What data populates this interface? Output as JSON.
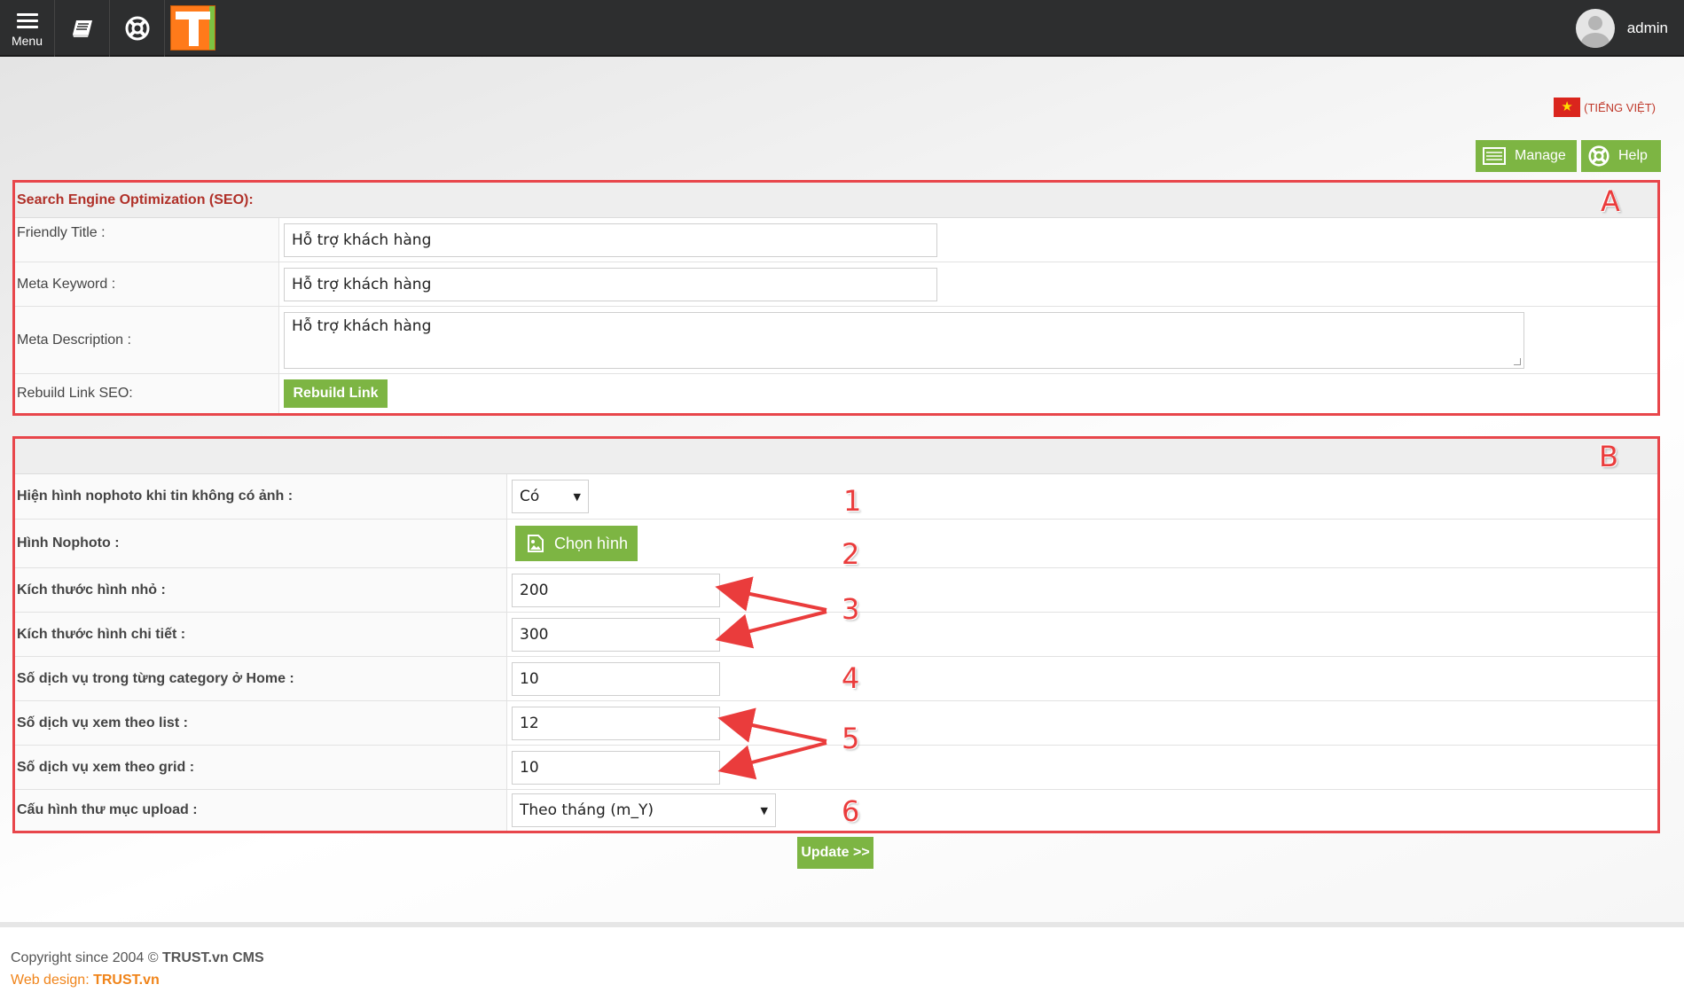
{
  "topbar": {
    "menu_label": "Menu",
    "user_name": "admin",
    "icons": {
      "menu": "hamburger-icon",
      "book": "book-icon",
      "help": "lifebuoy-icon",
      "logo": "trust-logo"
    }
  },
  "language": {
    "label": "(TIẾNG VIỆT)",
    "flag": "vietnam-flag-icon"
  },
  "actions": {
    "manage_label": "Manage",
    "help_label": "Help"
  },
  "seo": {
    "header": "Search Engine Optimization (SEO):",
    "friendly_title_label": "Friendly Title :",
    "friendly_title_value": "Hỗ trợ khách hàng",
    "meta_keyword_label": "Meta Keyword :",
    "meta_keyword_value": "Hỗ trợ khách hàng",
    "meta_description_label": "Meta Description :",
    "meta_description_value": "Hỗ trợ khách hàng",
    "rebuild_label": "Rebuild Link SEO:",
    "rebuild_button": "Rebuild Link"
  },
  "config": {
    "nophoto_show_label": "Hiện hình nophoto khi tin không có ảnh :",
    "nophoto_show_value": "Có",
    "nophoto_image_label": "Hình Nophoto :",
    "choose_image_button": "Chọn hình",
    "thumb_size_label": "Kích thước hình nhỏ :",
    "thumb_size_value": "200",
    "detail_size_label": "Kích thước hình chi tiết :",
    "detail_size_value": "300",
    "home_count_label": "Số dịch vụ trong từng category ở Home :",
    "home_count_value": "10",
    "list_count_label": "Số dịch vụ xem theo list :",
    "list_count_value": "12",
    "grid_count_label": "Số dịch vụ xem theo grid :",
    "grid_count_value": "10",
    "upload_folder_label": "Cấu hình thư mục upload :",
    "upload_folder_value": "Theo tháng (m_Y)",
    "update_button": "Update >>"
  },
  "annotations": {
    "a": "A",
    "b": "B",
    "n1": "1",
    "n2": "2",
    "n3": "3",
    "n4": "4",
    "n5": "5",
    "n6": "6"
  },
  "footer": {
    "copyright_prefix": "Copyright since 2004 © ",
    "copyright_brand": "TRUST.vn CMS",
    "webdesign_prefix": "Web design: ",
    "webdesign_brand": "TRUST.vn"
  },
  "colors": {
    "accent_green": "#7db543",
    "annotation_red": "#e8464b",
    "topbar": "#2d2e2f",
    "footer_orange": "#f0841a"
  }
}
